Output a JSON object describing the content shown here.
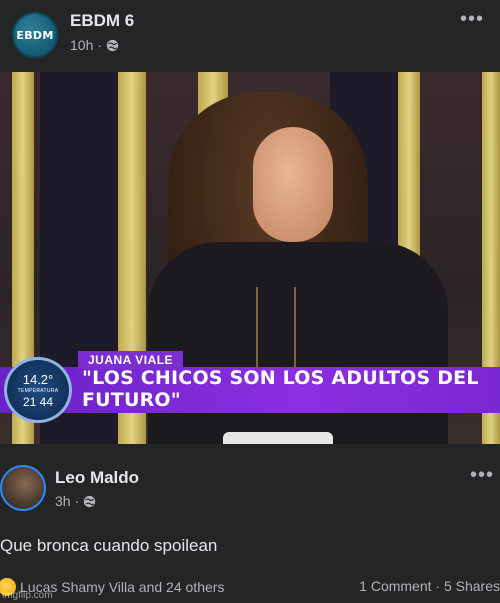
{
  "post": {
    "page_name": "EBDM 6",
    "avatar_text": "EBDM",
    "time": "10h",
    "more": "•••"
  },
  "image": {
    "chyron_name": "JUANA VIALE",
    "chyron_quote": "\"LOS CHICOS SON LOS ADULTOS DEL FUTURO\"",
    "badge_temp": "14.2°",
    "badge_label": "TEMPERATURA",
    "badge_time": "21 44"
  },
  "comment": {
    "author": "Leo Maldo",
    "time": "3h",
    "more": "•••",
    "text": "Que bronca cuando spoilean",
    "reactors": "Lucas Shamy Villa and 24 others",
    "stats": "1 Comment · 5 Shares"
  },
  "watermark": "imgflip.com",
  "colors": {
    "background": "#18191a",
    "card": "#242526",
    "chyron_purple": "#7b2fd0",
    "accent_blue": "#2d88ff"
  }
}
